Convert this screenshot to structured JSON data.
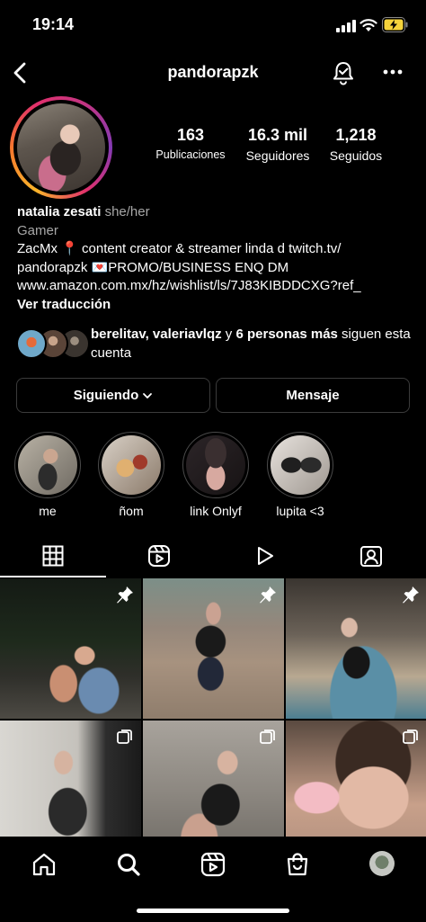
{
  "status_bar": {
    "time": "19:14"
  },
  "header": {
    "username": "pandorapzk"
  },
  "profile": {
    "stats": [
      {
        "value": "163",
        "label": "Publicaciones"
      },
      {
        "value": "16.3 mil",
        "label": "Seguidores"
      },
      {
        "value": "1,218",
        "label": "Seguidos"
      }
    ],
    "name": "natalia zesati",
    "pronouns": "she/her",
    "category": "Gamer",
    "bio_line1": "ZacMx 📍 content creator & streamer linda d twitch.tv/",
    "bio_line2": "pandorapzk 💌PROMO/BUSINESS ENQ DM",
    "bio_link": "www.amazon.com.mx/hz/wishlist/ls/7J83KIBDDCXG?ref_",
    "translate": "Ver traducción",
    "followed_by": {
      "names": "berelitav, valeriavlqz",
      "connector": " y ",
      "others": "6 personas más",
      "suffix": " siguen esta cuenta"
    }
  },
  "buttons": {
    "following": "Siguiendo",
    "message": "Mensaje"
  },
  "highlights": [
    {
      "label": "me"
    },
    {
      "label": "ñom"
    },
    {
      "label": "link Onlyf"
    },
    {
      "label": "lupita <3"
    }
  ],
  "tabs": [
    {
      "name": "grid",
      "icon": "grid-icon",
      "active": true
    },
    {
      "name": "reels",
      "icon": "reels-icon",
      "active": false
    },
    {
      "name": "videos",
      "icon": "play-icon",
      "active": false
    },
    {
      "name": "tagged",
      "icon": "tagged-person-icon",
      "active": false
    }
  ],
  "posts": [
    {
      "badge": "pin-icon"
    },
    {
      "badge": "pin-icon"
    },
    {
      "badge": "pin-icon"
    },
    {
      "badge": "multiple-icon"
    },
    {
      "badge": "multiple-icon"
    },
    {
      "badge": "multiple-icon"
    }
  ],
  "bottom_nav": [
    "home-icon",
    "search-icon",
    "reels-icon",
    "shop-icon",
    "profile-avatar"
  ],
  "colors": {
    "background": "#000000",
    "secondary_text": "#a8a8a8",
    "border": "#3b3b3b",
    "battery": "#f5d33b"
  }
}
